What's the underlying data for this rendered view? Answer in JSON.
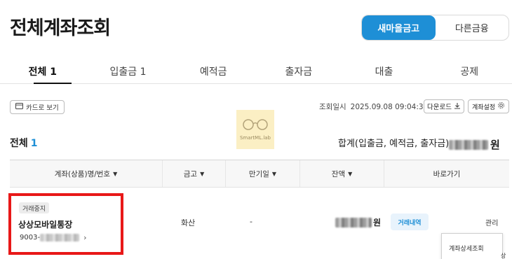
{
  "header": {
    "title": "전체계좌조회"
  },
  "segment": {
    "items": [
      "새마을금고",
      "다른금융"
    ],
    "active": 0
  },
  "tabs": [
    {
      "label": "전체 1",
      "active": true
    },
    {
      "label": "입출금 1",
      "active": false
    },
    {
      "label": "예적금",
      "active": false
    },
    {
      "label": "출자금",
      "active": false
    },
    {
      "label": "대출",
      "active": false
    },
    {
      "label": "공제",
      "active": false
    }
  ],
  "toolbar": {
    "card_view_label": "카드로 보기",
    "query_time_label": "조회일시",
    "query_time_value": "2025.09.08 09:04:31",
    "download_label": "다운로드",
    "settings_label": "계좌설정"
  },
  "watermark": {
    "text": "SmartML.lab"
  },
  "summary": {
    "total_label": "전체",
    "total_count": "1",
    "sum_label": "합계(입출금, 예적금, 출자금)",
    "sum_unit": "원"
  },
  "table": {
    "headers": [
      "계좌(상품)명/번호",
      "금고",
      "만기일",
      "잔액",
      "바로가기"
    ],
    "rows": [
      {
        "status": "거래중지",
        "product": "상상모바일통장",
        "account_prefix": "9003-",
        "bank": "화산",
        "maturity": "-",
        "balance_unit": "원",
        "tx_button": "거래내역",
        "manage_button": "관리"
      }
    ]
  },
  "popup": {
    "label": "계좌상세조회",
    "side_label": "상"
  },
  "colors": {
    "accent": "#1e8fd6",
    "highlight": "#e81818"
  }
}
